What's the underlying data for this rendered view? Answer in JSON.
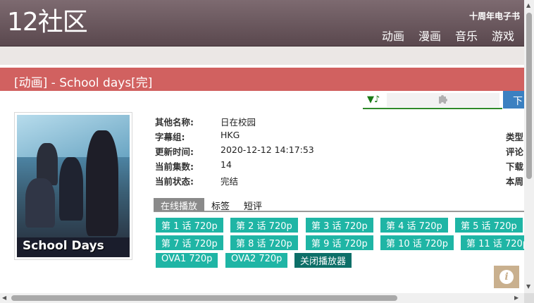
{
  "header": {
    "logo": "12社区",
    "ebook_link": "十周年电子书",
    "nav": [
      "动画",
      "漫画",
      "音乐",
      "游戏"
    ]
  },
  "title_bar": {
    "title": "[动画] - School days[完]"
  },
  "player_tools": {
    "music_glyph": "▼♪",
    "download_label": "下"
  },
  "cover": {
    "title": "School Days"
  },
  "info": [
    {
      "label": "其他名称:",
      "value": "日在校园"
    },
    {
      "label": "字幕组:",
      "value": "HKG"
    },
    {
      "label": "更新时间:",
      "value": "2020-12-12 14:17:53"
    },
    {
      "label": "当前集数:",
      "value": "14"
    },
    {
      "label": "当前状态:",
      "value": "完结"
    }
  ],
  "right_column": [
    "类型",
    "评论",
    "下载",
    "本周"
  ],
  "tabs": [
    "在线播放",
    "标签",
    "短评"
  ],
  "episodes": [
    "第 1 话 720p",
    "第 2 话 720p",
    "第 3 话 720p",
    "第 4 话 720p",
    "第 5 话 720p",
    "第 7 话 720p",
    "第 8 话 720p",
    "第 9 话 720p",
    "第 10 话 720p",
    "第 11 话 720p",
    "OVA1 720p",
    "OVA2 720p"
  ],
  "close_player": "关闭播放器",
  "colors": {
    "header": "#6a575d",
    "title_bar": "#d16160",
    "episode": "#1fb5a5",
    "close": "#0d6f68",
    "download": "#3b80c1"
  }
}
